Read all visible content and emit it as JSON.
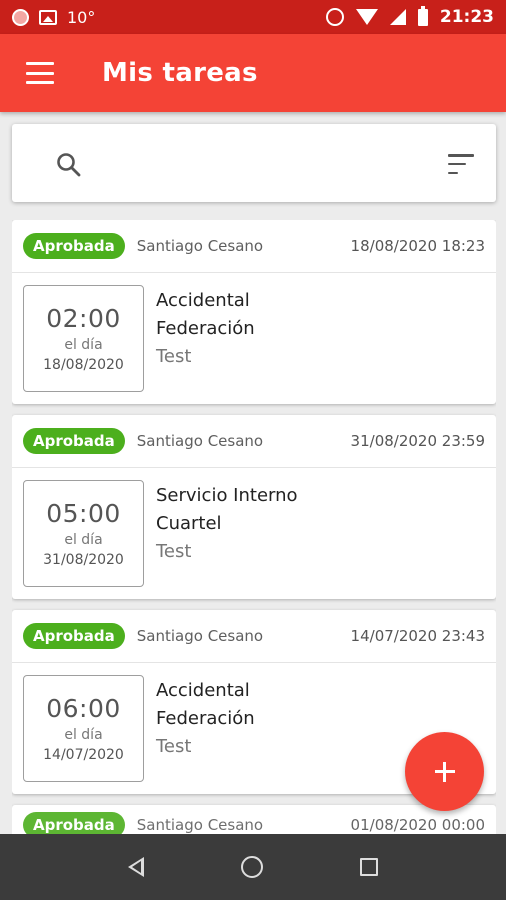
{
  "status_bar": {
    "temperature": "10°",
    "time": "21:23"
  },
  "app_bar": {
    "title": "Mis tareas"
  },
  "search": {
    "placeholder": ""
  },
  "tasks": [
    {
      "status": "Aprobada",
      "owner": "Santiago Cesano",
      "timestamp": "18/08/2020 18:23",
      "time": "02:00",
      "day_label": "el día",
      "date": "18/08/2020",
      "title_line1": "Accidental",
      "title_line2": "Federación",
      "subtitle": "Test"
    },
    {
      "status": "Aprobada",
      "owner": "Santiago Cesano",
      "timestamp": "31/08/2020 23:59",
      "time": "05:00",
      "day_label": "el día",
      "date": "31/08/2020",
      "title_line1": "Servicio Interno",
      "title_line2": "Cuartel",
      "subtitle": "Test"
    },
    {
      "status": "Aprobada",
      "owner": "Santiago Cesano",
      "timestamp": "14/07/2020 23:43",
      "time": "06:00",
      "day_label": "el día",
      "date": "14/07/2020",
      "title_line1": "Accidental",
      "title_line2": "Federación",
      "subtitle": "Test"
    },
    {
      "status": "Aprobada",
      "owner": "Santiago Cesano",
      "timestamp": "01/08/2020 00:00"
    }
  ],
  "colors": {
    "status_bar": "#c8201a",
    "app_bar": "#f44336",
    "badge_approved": "#4caf1d",
    "fab": "#f44336",
    "nav_bar": "#3b3b3b"
  },
  "icons": {
    "menu": "menu-icon",
    "search": "search-icon",
    "filter": "filter-icon",
    "add": "plus-icon",
    "back": "back-icon",
    "home": "home-icon",
    "recents": "recents-icon"
  }
}
